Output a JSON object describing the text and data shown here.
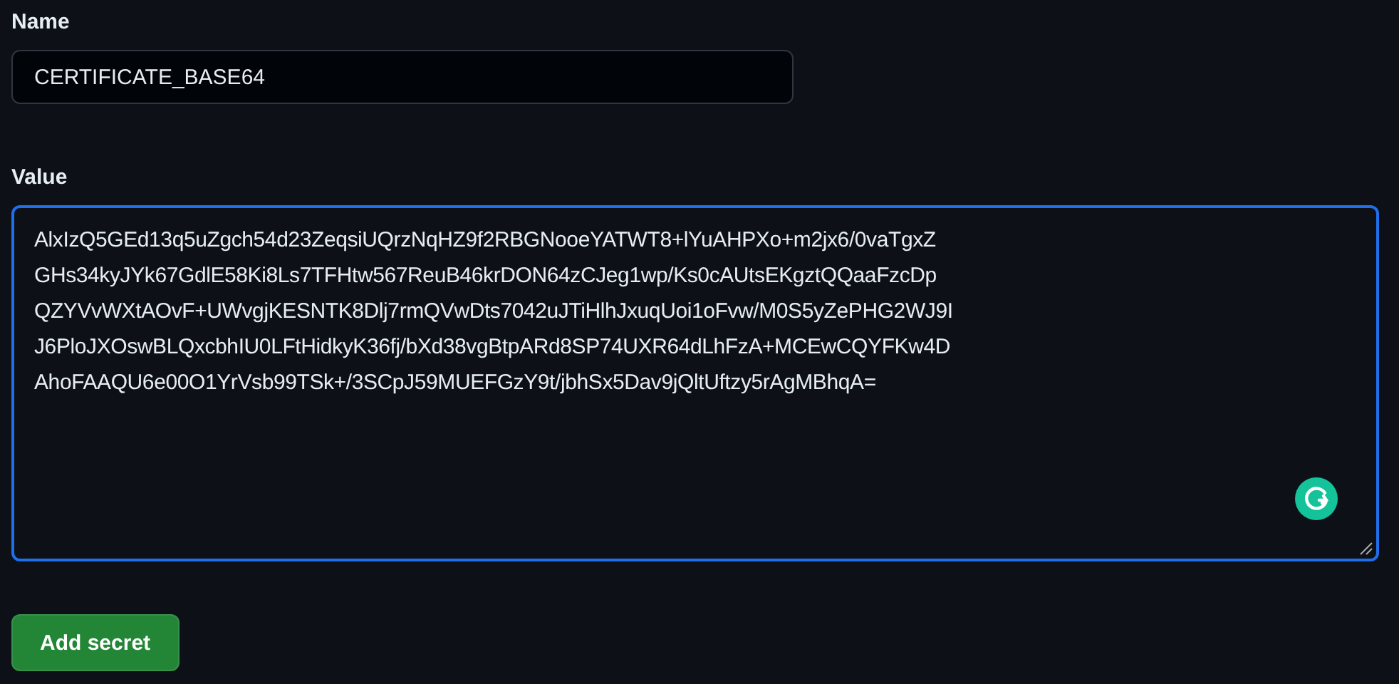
{
  "name_field": {
    "label": "Name",
    "value": "CERTIFICATE_BASE64"
  },
  "value_field": {
    "label": "Value",
    "lines": [
      "AlxIzQ5GEd13q5uZgch54d23ZeqsiUQrzNqHZ9f2RBGNooeYATWT8+lYuAHPXo+m2jx6/0vaTgxZ",
      "GHs34kyJYk67GdlE58Ki8Ls7TFHtw567ReuB46krDON64zCJeg1wp/Ks0cAUtsEKgztQQaaFzcDp",
      "QZYVvWXtAOvF+UWvgjKESNTK8Dlj7rmQVwDts7042uJTiHlhJxuqUoi1oFvw/M0S5yZePHG2WJ9I",
      "J6PloJXOswBLQxcbhIU0LFtHidkyK36fj/bXd38vgBtpARd8SP74UXR64dLhFzA+MCEwCQYFKw4D",
      "AhoFAAQU6e00O1YrVsb99TSk+/3SCpJ59MUEFGzY9t/jbhSx5Dav9jQltUftzy5rAgMBhqA="
    ],
    "focused": true
  },
  "button": {
    "label": "Add secret"
  }
}
